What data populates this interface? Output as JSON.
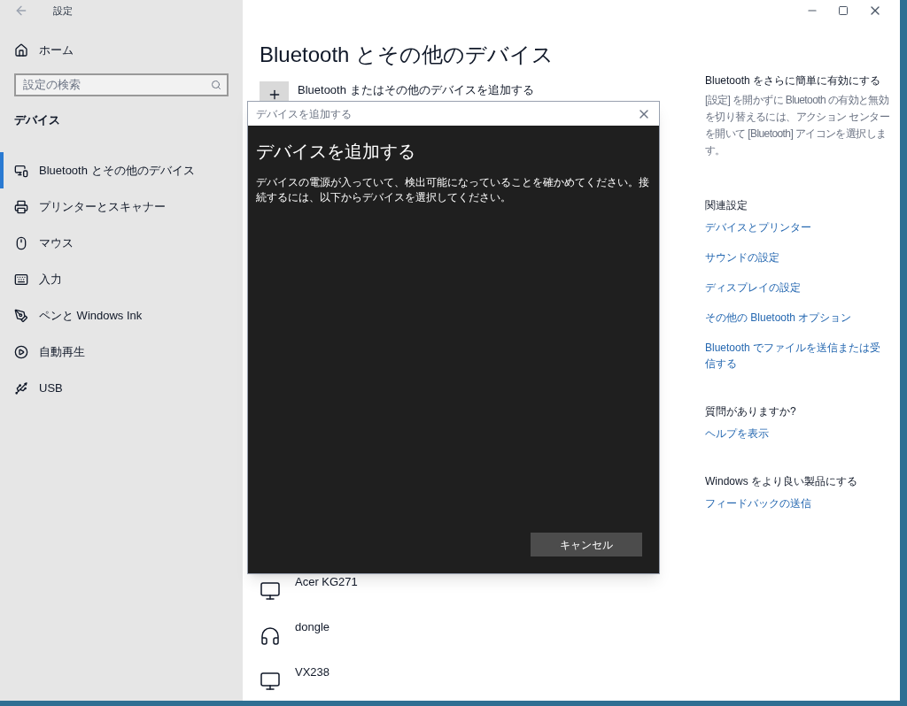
{
  "window": {
    "title": "設定"
  },
  "sidebar": {
    "home": "ホーム",
    "search": {
      "placeholder": "設定の検索"
    },
    "section": "デバイス",
    "items": [
      {
        "label": "Bluetooth とその他のデバイス",
        "selected": true
      },
      {
        "label": "プリンターとスキャナー",
        "selected": false
      },
      {
        "label": "マウス",
        "selected": false
      },
      {
        "label": "入力",
        "selected": false
      },
      {
        "label": "ペンと Windows Ink",
        "selected": false
      },
      {
        "label": "自動再生",
        "selected": false
      },
      {
        "label": "USB",
        "selected": false
      }
    ]
  },
  "main": {
    "title": "Bluetooth とその他のデバイス",
    "add_device": "Bluetooth またはその他のデバイスを追加する",
    "devices": [
      {
        "name": "Acer KG271",
        "kind": "monitor"
      },
      {
        "name": "dongle",
        "kind": "headset"
      },
      {
        "name": "VX238",
        "kind": "monitor"
      }
    ]
  },
  "dialog": {
    "title": "デバイスを追加する",
    "heading": "デバイスを追加する",
    "description": "デバイスの電源が入っていて、検出可能になっていることを確かめてください。接続するには、以下からデバイスを選択してください。",
    "cancel": "キャンセル"
  },
  "right_panel": {
    "sections": [
      {
        "heading": "Bluetooth をさらに簡単に有効にする",
        "text": "[設定] を開かずに Bluetooth の有効と無効を切り替えるには、アクション センターを開いて [Bluetooth] アイコンを選択します。"
      },
      {
        "heading": "関連設定",
        "links": [
          "デバイスとプリンター",
          "サウンドの設定",
          "ディスプレイの設定",
          "その他の Bluetooth オプション",
          "Bluetooth でファイルを送信または受信する"
        ]
      },
      {
        "heading": "質問がありますか?",
        "links": [
          "ヘルプを表示"
        ]
      },
      {
        "heading": "Windows をより良い製品にする",
        "links": [
          "フィードバックの送信"
        ]
      }
    ]
  }
}
